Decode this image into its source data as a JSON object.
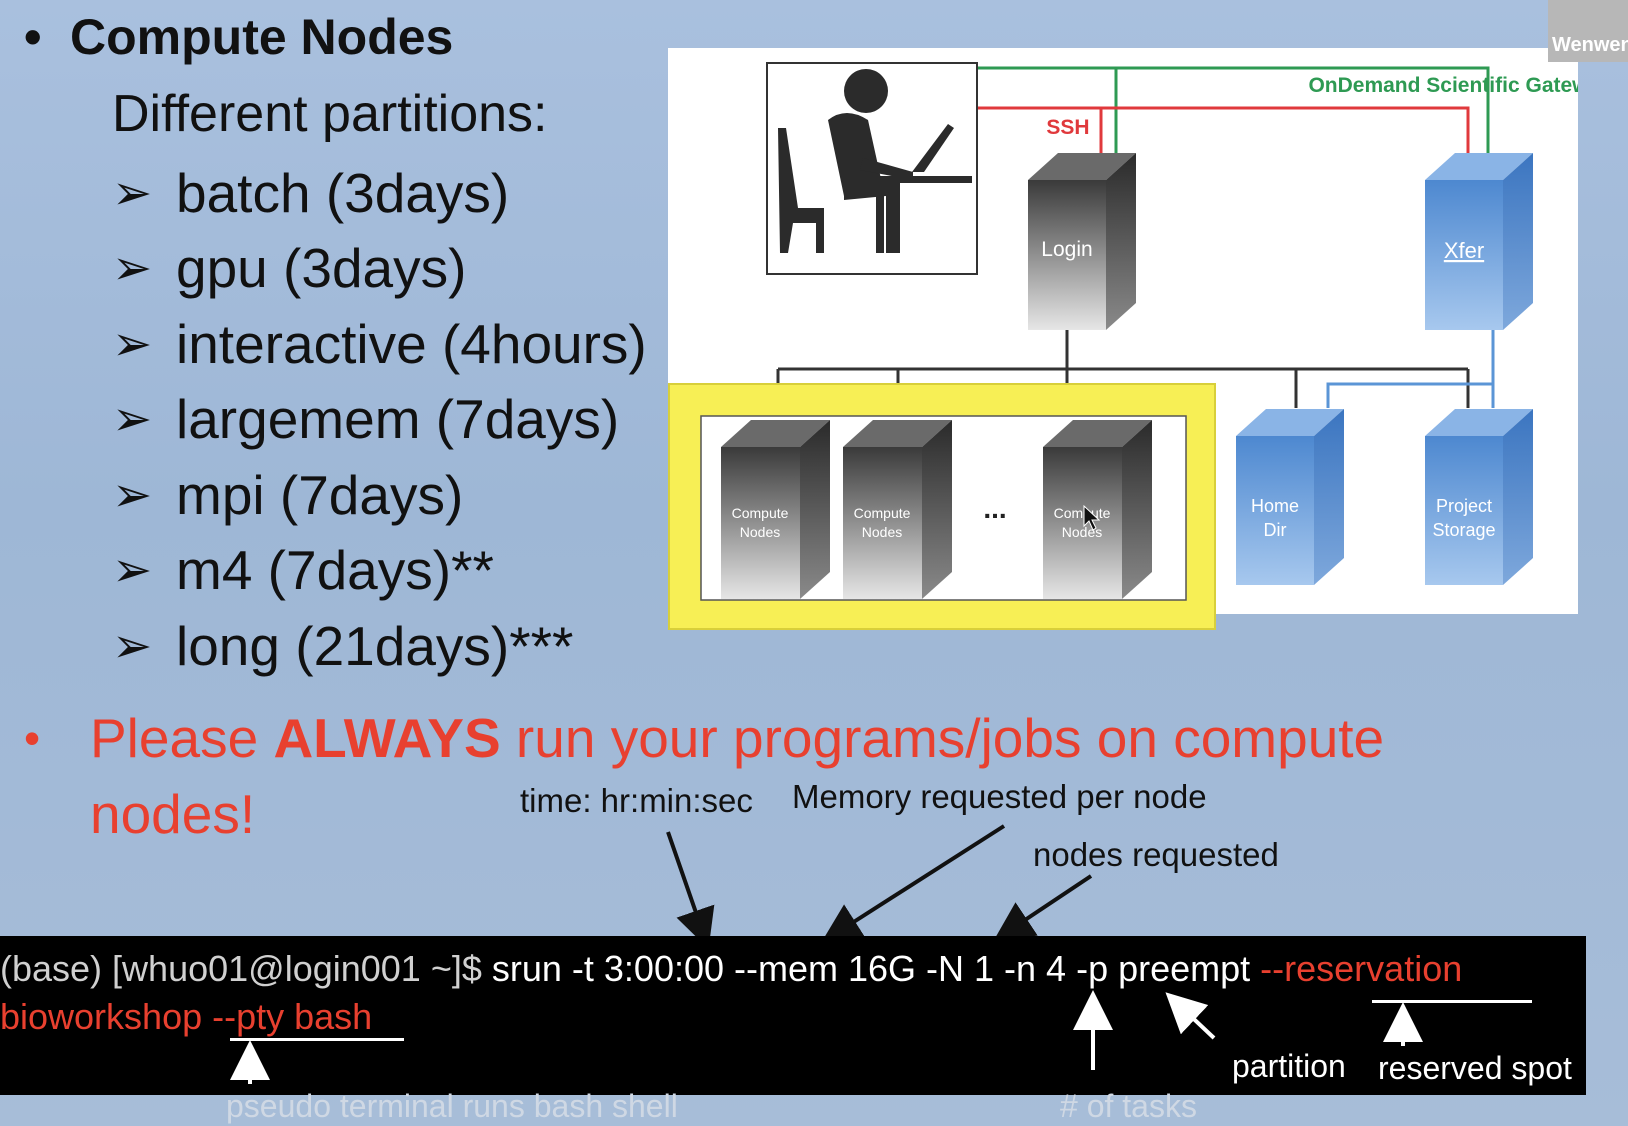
{
  "slide": {
    "heading_bullet": "•",
    "heading": "Compute Nodes",
    "subheading": "Different partitions:",
    "partitions": [
      "batch (3days)",
      "gpu (3days)",
      "interactive (4hours)",
      "largemem (7days)",
      "mpi (7days)",
      "m4 (7days)**",
      "long (21days)***"
    ],
    "warning": {
      "bullet": "•",
      "prefix": "Please ",
      "emphasis": "ALWAYS",
      "rest_line1": " run your programs/jobs on compute",
      "line2": "nodes!"
    }
  },
  "diagram": {
    "gateway_label": "OnDemand Scientific Gateways",
    "ssh_label": "SSH",
    "login_label": "Login",
    "xfer_label": "Xfer",
    "compute_label_1": "Compute",
    "compute_label_2": "Nodes",
    "ellipsis": "...",
    "home_label_1": "Home",
    "home_label_2": "Dir",
    "project_label_1": "Project",
    "project_label_2": "Storage",
    "colors": {
      "gateway_line": "#2e9a53",
      "ssh_line": "#e0393c",
      "highlight": "#f7ef55",
      "storage_blue": "#5b95d6"
    }
  },
  "annotations": {
    "time": "time: hr:min:sec",
    "memory": "Memory requested per node",
    "nodes": "nodes requested",
    "partition": "partition",
    "reserved": "reserved spot",
    "tasks": "# of tasks",
    "pty": "pseudo terminal runs bash shell"
  },
  "terminal": {
    "prompt": "(base) [whuo01@login001 ~]$ ",
    "command": "srun -t 3:00:00 --mem 16G -N 1 -n 4 -p preempt ",
    "reservation_flag": "--reservation",
    "reservation_value": "bioworkshop ",
    "pty_flag": "--pty bash"
  },
  "webcam": {
    "name": "Wenwen"
  }
}
